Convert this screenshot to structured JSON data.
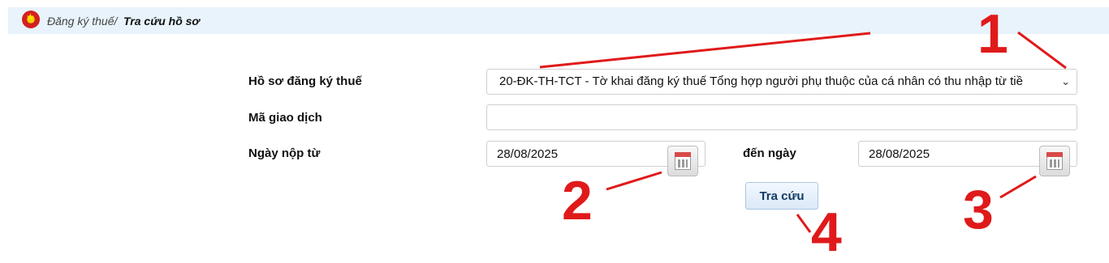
{
  "breadcrumb": {
    "parent": "Đăng ký thuế/",
    "current": "Tra cứu hồ sơ"
  },
  "form": {
    "dossier_label": "Hồ sơ đăng ký thuế",
    "dossier_value": "20-ĐK-TH-TCT - Tờ khai đăng ký thuế Tổng hợp người phụ thuộc của cá nhân có thu nhập từ tiề",
    "transaction_label": "Mã giao dịch",
    "transaction_value": "",
    "from_date_label": "Ngày nộp từ",
    "from_date_value": "28/08/2025",
    "to_date_label": "đến ngày",
    "to_date_value": "28/08/2025",
    "search_button": "Tra cứu"
  },
  "annotations": {
    "one": "1",
    "two": "2",
    "three": "3",
    "four": "4"
  },
  "icons": {
    "emblem": "national-emblem-icon",
    "dropdown": "chevron-down-icon",
    "calendar": "calendar-icon"
  },
  "colors": {
    "annotation": "#e01a1a",
    "breadcrumb_bg": "#e8f3fb",
    "button_text": "#123a63"
  }
}
